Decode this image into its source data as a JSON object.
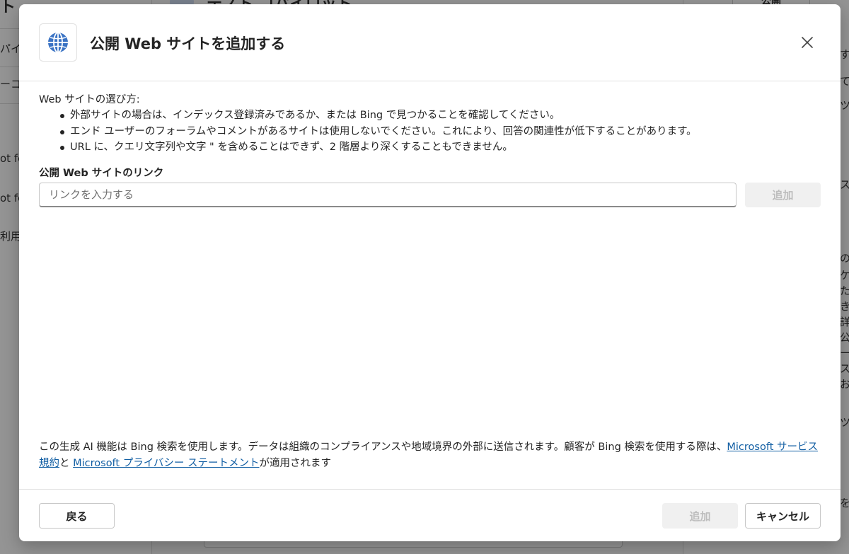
{
  "background": {
    "app_title": "テスト コパイロット",
    "publish_label": "公開",
    "sidebar_fragments": [
      "ト",
      "パイ",
      "ーコ",
      "ot fo",
      "ot fo",
      "利用し"
    ],
    "right_fragments": [
      "す",
      "て",
      "ツ",
      "ス",
      "の",
      "ケ",
      "た",
      "き",
      "詳",
      "公",
      "ー",
      "ス",
      "お",
      "ツ",
      "を"
    ]
  },
  "dialog": {
    "title": "公開 Web サイトを追加する",
    "header_icon": "globe-icon",
    "close_icon": "close-icon",
    "intro": "Web サイトの選び方:",
    "guidelines": [
      "外部サイトの場合は、インデックス登録済みであるか、または Bing で見つかることを確認してください。",
      "エンド ユーザーのフォーラムやコメントがあるサイトは使用しないでください。これにより、回答の関連性が低下することがあります。",
      "URL に、クエリ文字列や文字 \" を含めることはできず、2 階層より深くすることもできません。"
    ],
    "link_label": "公開 Web サイトのリンク",
    "link_input": {
      "value": "",
      "placeholder": "リンクを入力する"
    },
    "add_button": "追加",
    "disclaimer": {
      "text": "この生成 AI 機能は Bing 検索を使用します。データは組織のコンプライアンスや地域境界の外部に送信されます。顧客が Bing 検索を使用する際は、",
      "link1": "Microsoft サービス規約",
      "between": "と ",
      "link2": "Microsoft プライバシー ステートメント",
      "suffix": "が適用されます"
    },
    "footer": {
      "back_button": "戻る",
      "add_button": "追加",
      "cancel_button": "キャンセル"
    }
  },
  "colors": {
    "link": "#115ea3",
    "globe": "#3a73c4",
    "disabled_bg": "#f0f0f0",
    "disabled_text": "#bdbdbd"
  }
}
